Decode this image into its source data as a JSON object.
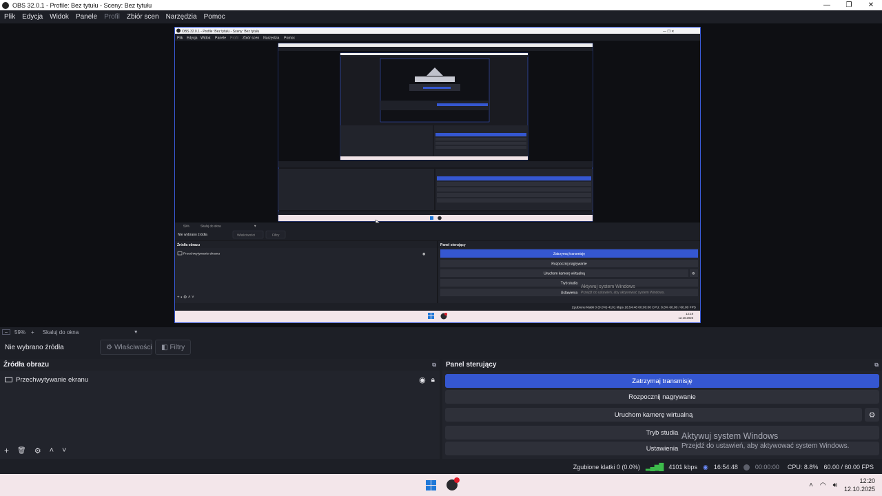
{
  "window": {
    "title": "OBS 32.0.1 - Profile: Bez tytułu - Sceny: Bez tytułu",
    "controls": [
      "—",
      "❐",
      "✕"
    ]
  },
  "menu": {
    "items": [
      "Plik",
      "Edycja",
      "Widok",
      "Panele",
      "Profil",
      "Zbiór scen",
      "Narzędzia",
      "Pomoc"
    ]
  },
  "zoom": {
    "percent": "59%",
    "scale_mode": "Skaluj do okna"
  },
  "props_bar": {
    "no_source": "Nie wybrano źródła",
    "properties_label": "Właściwości",
    "filters_label": "Filtry"
  },
  "sources": {
    "title": "Źródła obrazu",
    "items": [
      {
        "name": "Przechwytywanie ekranu"
      }
    ]
  },
  "controls": {
    "title": "Panel sterujący",
    "stop_stream": "Zatrzymaj transmisję",
    "start_record": "Rozpocznij nagrywanie",
    "virtual_cam": "Uruchom kamerę wirtualną",
    "studio_mode": "Tryb studia",
    "settings": "Ustawienia"
  },
  "watermark": {
    "line1": "Aktywuj system Windows",
    "line2": "Przejdź do ustawień, aby aktywować system Windows."
  },
  "status": {
    "dropped": "Zgubione klatki 0 (0.0%)",
    "bitrate": "4101 kbps",
    "stream_time": "16:54:48",
    "rec_time": "00:00:00",
    "cpu": "CPU: 8.8%",
    "fps": "60.00 / 60.00 FPS"
  },
  "taskbar": {
    "time": "12:20",
    "date": "12.10.2025"
  },
  "nested": {
    "title": "OBS 32.0.1 - Profile: Bez tytułu - Sceny: Bez tytułu",
    "menu": [
      "Plik",
      "Edycja",
      "Widok",
      "Panele",
      "Profil",
      "Zbiór scen",
      "Narzędzia",
      "Pomoc"
    ],
    "zoom": "59%",
    "scale_mode": "Skaluj do okna",
    "no_source": "Nie wybrano źródła",
    "properties": "Właściwości",
    "filters": "Filtry",
    "sources_title": "Źródła obrazu",
    "source_item": "Przechwytywanie ekranu",
    "controls_title": "Panel sterujący",
    "stop_stream": "Zatrzymaj transmisję",
    "start_record": "Rozpocznij nagrywanie",
    "virtual_cam": "Uruchom kamerę wirtualną",
    "studio_mode": "Tryb studia",
    "settings": "Ustawienia",
    "wm1": "Aktywuj system Windows",
    "wm2": "Przejdź do ustawień, aby aktywować system Windows.",
    "status": "Zgubione klatki 0 (0.0%)   4101 kbps   16:54:48   00:00:00   CPU: 8.8%   60.00 / 60.00 FPS",
    "time": "12:19",
    "date": "12.10.2025"
  }
}
